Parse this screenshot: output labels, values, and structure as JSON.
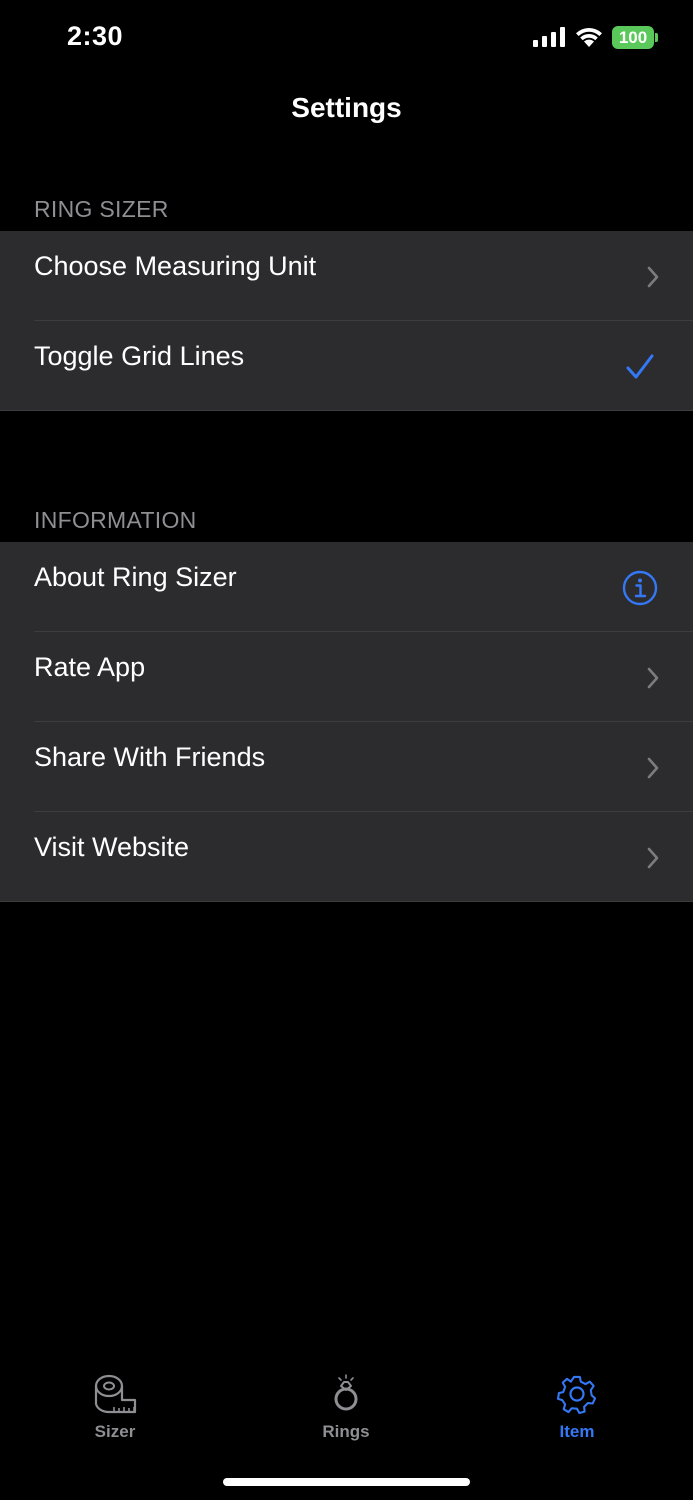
{
  "status_bar": {
    "time": "2:30",
    "battery": "100",
    "signal_icon": "cellular-signal-icon",
    "wifi_icon": "wifi-icon"
  },
  "nav": {
    "title": "Settings"
  },
  "sections": [
    {
      "header": "RING SIZER",
      "rows": [
        {
          "label": "Choose Measuring Unit",
          "accessory": "chevron-right-icon"
        },
        {
          "label": "Toggle Grid Lines",
          "accessory": "checkmark-icon"
        }
      ]
    },
    {
      "header": "INFORMATION",
      "rows": [
        {
          "label": "About Ring Sizer",
          "accessory": "info-circle-icon"
        },
        {
          "label": "Rate App",
          "accessory": "chevron-right-icon"
        },
        {
          "label": "Share With Friends",
          "accessory": "chevron-right-icon"
        },
        {
          "label": "Visit Website",
          "accessory": "chevron-right-icon"
        }
      ]
    }
  ],
  "tab_bar": {
    "tabs": [
      {
        "label": "Sizer",
        "icon": "measuring-tape-icon",
        "active": false
      },
      {
        "label": "Rings",
        "icon": "ring-icon",
        "active": false
      },
      {
        "label": "Item",
        "icon": "gear-icon",
        "active": true
      }
    ]
  },
  "colors": {
    "background": "#000000",
    "cell_background": "#2c2c2e",
    "accent": "#3478f6",
    "secondary_text": "#8e8e93",
    "battery": "#5ac85a"
  }
}
